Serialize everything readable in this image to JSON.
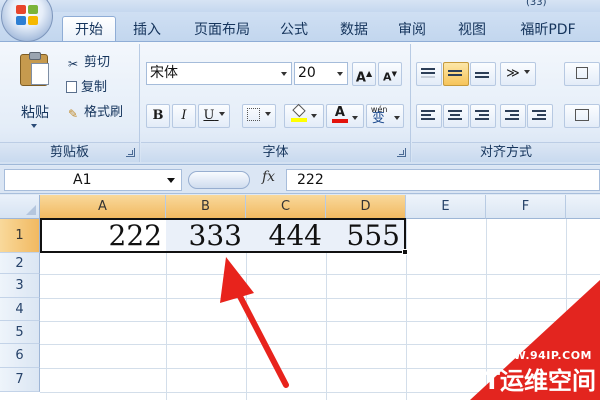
{
  "window": {
    "title_fragment": "(33)"
  },
  "tabs": [
    {
      "label": "开始",
      "active": true
    },
    {
      "label": "插入"
    },
    {
      "label": "页面布局"
    },
    {
      "label": "公式"
    },
    {
      "label": "数据"
    },
    {
      "label": "审阅"
    },
    {
      "label": "视图"
    },
    {
      "label": "福昕PDF"
    }
  ],
  "clipboard": {
    "paste_label": "粘贴",
    "cut_label": "剪切",
    "copy_label": "复制",
    "format_painter_label": "格式刷",
    "group_label": "剪贴板"
  },
  "font": {
    "name": "宋体",
    "size": "20",
    "grow_label": "A",
    "shrink_label": "A",
    "bold": "B",
    "italic": "I",
    "underline": "U",
    "font_color_glyph": "A",
    "phonetic_glyph": "变",
    "phonetic_small": "wén",
    "group_label": "字体"
  },
  "alignment": {
    "group_label": "对齐方式"
  },
  "formula_bar": {
    "name_box": "A1",
    "fx": "fx",
    "value": "222"
  },
  "grid": {
    "columns": [
      "A",
      "B",
      "C",
      "D",
      "E",
      "F"
    ],
    "rows": [
      "1",
      "2",
      "3",
      "4",
      "5",
      "6",
      "7"
    ],
    "row1_values": [
      "222",
      "333",
      "444",
      "555"
    ]
  },
  "watermark": {
    "url": "WWW.94IP.COM",
    "brand": "IT运维空间"
  },
  "colors": {
    "accent_red": "#e3251f",
    "selection_header": "#f1b961"
  }
}
